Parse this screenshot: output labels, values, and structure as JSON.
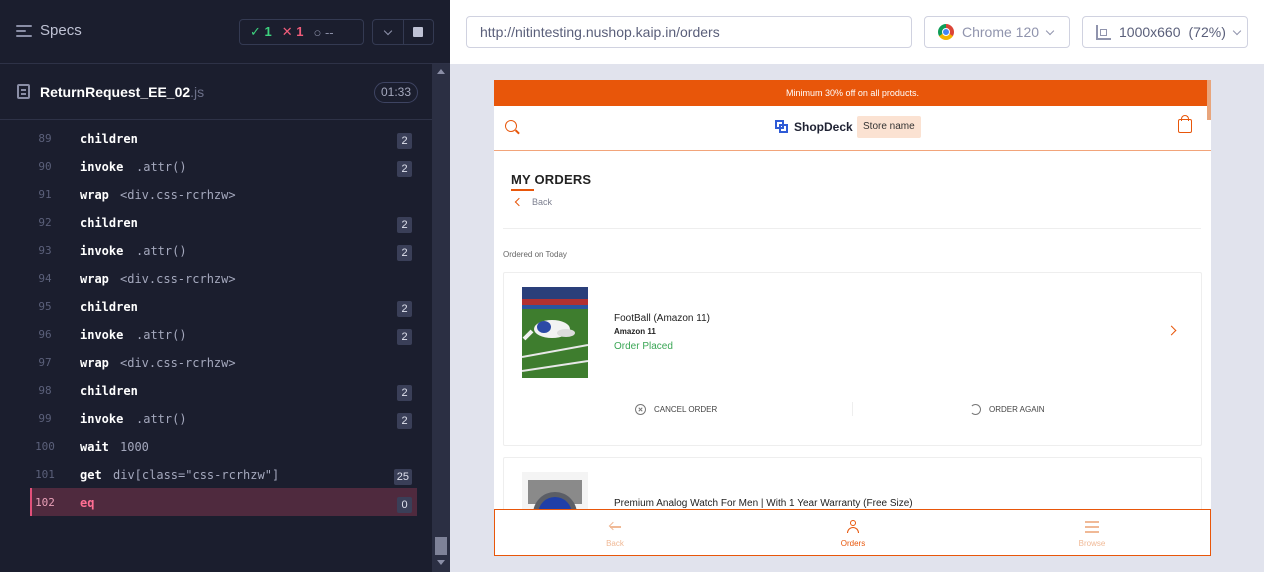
{
  "runner": {
    "header": {
      "specs_label": "Specs",
      "passed": "1",
      "failed": "1",
      "pending": "--"
    },
    "spec": {
      "name": "ReturnRequest_EE_02",
      "ext": ".js",
      "duration": "01:33"
    },
    "commands": [
      {
        "num": "89",
        "name": "children",
        "msg": "",
        "badge": "2"
      },
      {
        "num": "90",
        "name": "invoke",
        "msg": ".attr()",
        "badge": "2"
      },
      {
        "num": "91",
        "name": "wrap",
        "msg": "<div.css-rcrhzw>",
        "badge": ""
      },
      {
        "num": "92",
        "name": "children",
        "msg": "",
        "badge": "2"
      },
      {
        "num": "93",
        "name": "invoke",
        "msg": ".attr()",
        "badge": "2"
      },
      {
        "num": "94",
        "name": "wrap",
        "msg": "<div.css-rcrhzw>",
        "badge": ""
      },
      {
        "num": "95",
        "name": "children",
        "msg": "",
        "badge": "2"
      },
      {
        "num": "96",
        "name": "invoke",
        "msg": ".attr()",
        "badge": "2"
      },
      {
        "num": "97",
        "name": "wrap",
        "msg": "<div.css-rcrhzw>",
        "badge": ""
      },
      {
        "num": "98",
        "name": "children",
        "msg": "",
        "badge": "2"
      },
      {
        "num": "99",
        "name": "invoke",
        "msg": ".attr()",
        "badge": "2"
      },
      {
        "num": "100",
        "name": "wait",
        "msg": "1000",
        "badge": ""
      },
      {
        "num": "101",
        "name": "get",
        "msg": "div[class=\"css-rcrhzw\"]",
        "badge": "25"
      },
      {
        "num": "102",
        "name": "eq",
        "msg": "",
        "badge": "0",
        "active": true
      }
    ]
  },
  "aut": {
    "url": "http://nitintesting.nushop.kaip.in/orders",
    "browser": "Chrome 120",
    "viewport": "1000x660",
    "scale": "(72%)"
  },
  "app": {
    "promo": "Minimum 30% off on all products.",
    "logo": "ShopDeck",
    "store_name": "Store name",
    "page_title": "MY ORDERS",
    "back": "Back",
    "ordered_on": "Ordered on Today",
    "orders": [
      {
        "name": "FootBall (Amazon 11)",
        "brand": "Amazon 11",
        "status": "Order Placed",
        "cancel": "CANCEL ORDER",
        "again": "ORDER AGAIN"
      },
      {
        "name": "Premium Analog Watch For Men | With 1 Year Warranty (Free Size)"
      }
    ],
    "nav": {
      "back": "Back",
      "orders": "Orders",
      "browse": "Browse"
    }
  },
  "colors": {
    "accent": "#e8560a",
    "pass": "#3dd27e",
    "fail": "#f05c7a",
    "active_row": "#4f2a3e"
  }
}
